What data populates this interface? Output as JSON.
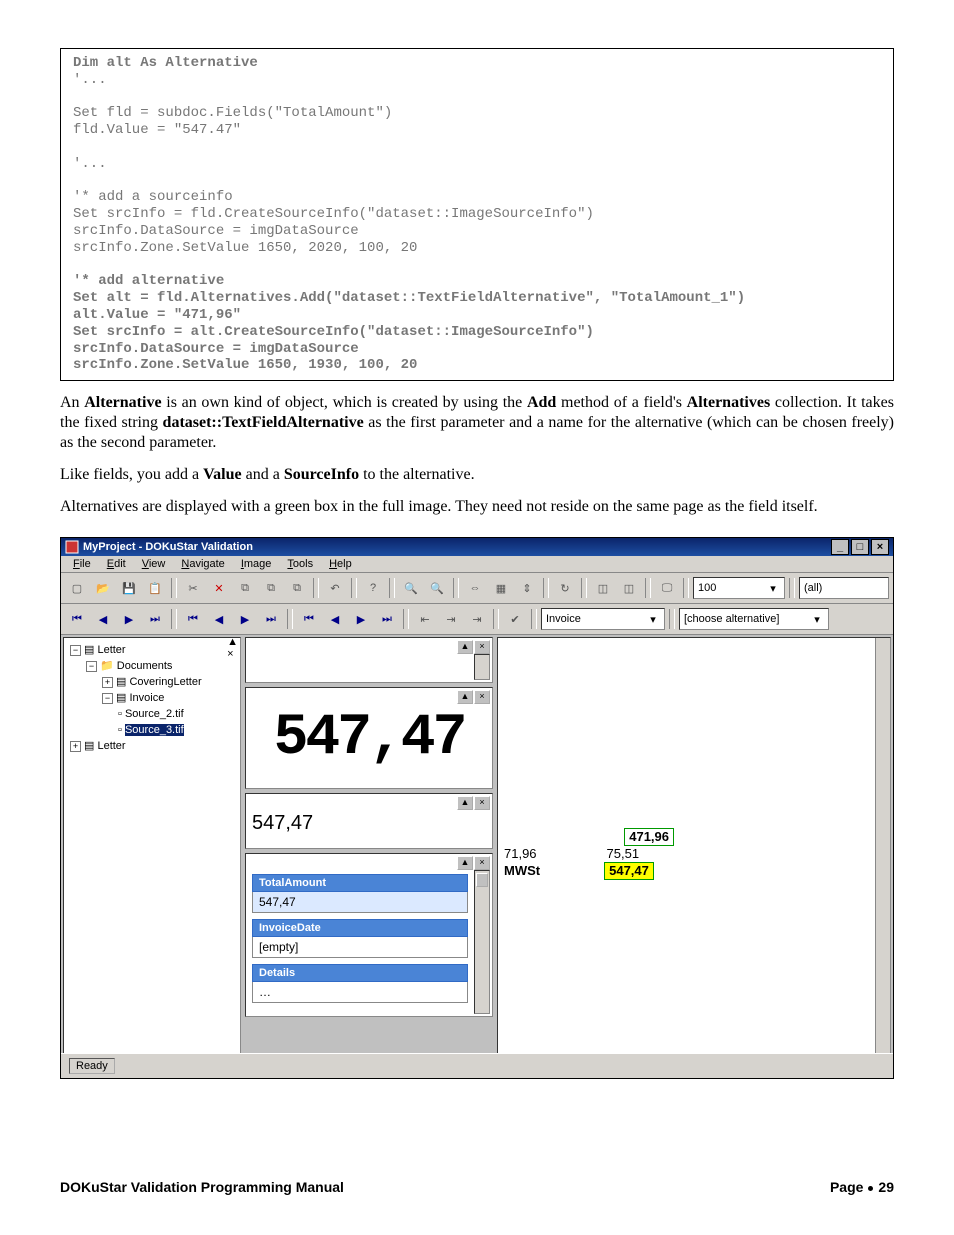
{
  "code_plain_1": "Dim alt As Alternative",
  "code_plain_2": "'...\n\nSet fld = subdoc.Fields(\"TotalAmount\")\nfld.Value = \"547.47\"\n\n'...\n\n'* add a sourceinfo\nSet srcInfo = fld.CreateSourceInfo(\"dataset::ImageSourceInfo\")\nsrcInfo.DataSource = imgDataSource\nsrcInfo.Zone.SetValue 1650, 2020, 100, 20\n",
  "code_bold_block": "'* add alternative\nSet alt = fld.Alternatives.Add(\"dataset::TextFieldAlternative\", \"TotalAmount_1\")\nalt.Value = \"471,96\"\nSet srcInfo = alt.CreateSourceInfo(\"dataset::ImageSourceInfo\")\nsrcInfo.DataSource = imgDataSource\nsrcInfo.Zone.SetValue 1650, 1930, 100, 20",
  "para1_a": "An ",
  "para1_b": "Alternative",
  "para1_c": " is an own kind of object, which is created by using the ",
  "para1_d": "Add",
  "para1_e": " method of a field's ",
  "para1_f": "Alternatives",
  "para1_g": " collection. It takes the fixed string ",
  "para1_h": "dataset::TextFieldAlternative",
  "para1_i": " as the first parameter and a name for the alternative (which can be chosen freely) as the second parameter.",
  "para2_a": "Like fields, you add a ",
  "para2_b": "Value",
  "para2_c": " and a ",
  "para2_d": "SourceInfo",
  "para2_e": " to the alternative.",
  "para3": "Alternatives are displayed with a green box in the full image. They need not reside on the same page as the field itself.",
  "shot": {
    "title": "MyProject - DOKuStar Validation",
    "menu": {
      "file": "File",
      "edit": "Edit",
      "view": "View",
      "navigate": "Navigate",
      "image": "Image",
      "tools": "Tools",
      "help": "Help"
    },
    "zoom": "100",
    "filter": "(all)",
    "doctype": "Invoice",
    "altcombo": "[choose alternative]",
    "tree": {
      "n0": "Letter",
      "n1": "Documents",
      "n2": "CoveringLetter",
      "n3": "Invoice",
      "n4": "Source_2.tif",
      "n5": "Source_3.tif",
      "n6": "Letter"
    },
    "bigvalue": "547,47",
    "editvalue": "547,47",
    "fields": {
      "f1_label": "TotalAmount",
      "f1_val": "547,47",
      "f2_label": "InvoiceDate",
      "f2_val": "[empty]",
      "f3_label": "Details",
      "f3_val": "…"
    },
    "right": {
      "alt_green": "471,96",
      "val1": "71,96",
      "val2": "75,51",
      "mwst": "MWSt",
      "sel": "547,47"
    },
    "status": "Ready"
  },
  "footer_left": "DOKuStar Validation Programming Manual",
  "footer_right_a": "Page",
  "footer_right_b": "29"
}
